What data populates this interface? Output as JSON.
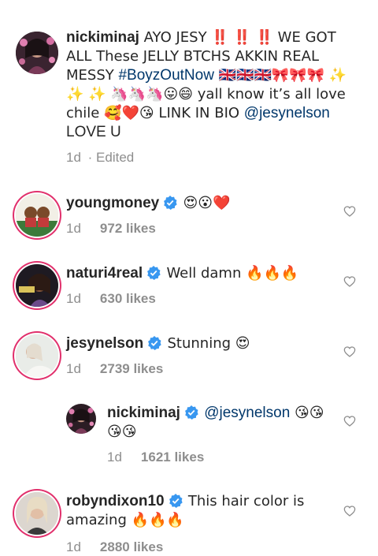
{
  "comments": [
    {
      "username": "nickiminaj",
      "verified": false,
      "text_pre": " AYO JESY ‼️ ‼️ ‼️ WE GOT ALL These JELLY BTCHS AKKIN REAL MESSY ",
      "hashtag": "#BoyzOutNow",
      "text_mid": " 🇬🇧🇬🇧🇬🇧🎀🎀🎀 ✨ ✨ ✨ 🦄🦄🦄😛😄 yall know it’s all love chile 🥰❤️😘 LINK IN BIO ",
      "mention": "@jesynelson",
      "text_post": " LOVE U",
      "time": "1d",
      "edited": "· Edited"
    },
    {
      "username": "youngmoney",
      "verified": true,
      "text": "😍😮❤️",
      "time": "1d",
      "likes": "972 likes"
    },
    {
      "username": "naturi4real",
      "verified": true,
      "text": "Well damn 🔥🔥🔥",
      "time": "1d",
      "likes": "630 likes"
    },
    {
      "username": "jesynelson",
      "verified": true,
      "text": "Stunning 😍",
      "time": "1d",
      "likes": "2739 likes"
    },
    {
      "username": "nickiminaj",
      "verified": true,
      "mention": "@jesynelson",
      "text": " 😘😘😘😘",
      "time": "1d",
      "likes": "1621 likes"
    },
    {
      "username": "robyndixon10",
      "verified": true,
      "text": "This hair color is amazing 🔥🔥🔥",
      "time": "1d",
      "likes": "2880 likes"
    }
  ],
  "icons": {
    "verified": "verified-badge-icon",
    "like": "heart-outline-icon"
  },
  "colors": {
    "verified_blue": "#3897f0",
    "link": "#00376b",
    "meta_gray": "#8e8e8e",
    "story_ring": "#e1306c"
  }
}
